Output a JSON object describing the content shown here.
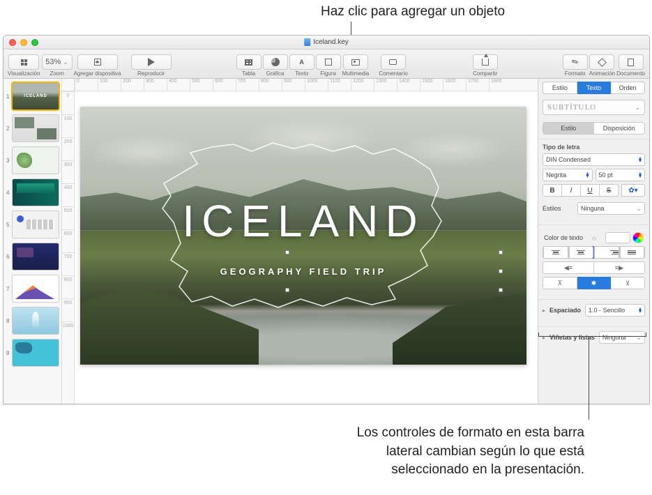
{
  "callouts": {
    "top": "Haz clic para agregar un objeto",
    "bottom": "Los controles de formato en esta barra\nlateral cambian según lo que está\nseleccionado en la presentación."
  },
  "window": {
    "title": "Iceland.key"
  },
  "toolbar": {
    "view": "Visualización",
    "zoom_value": "53%",
    "zoom": "Zoom",
    "add_slide": "Agregar dispositiva",
    "play": "Reproducir",
    "table": "Tabla",
    "chart": "Gráfica",
    "text": "Texto",
    "shape": "Figura",
    "media": "Multimedia",
    "comment": "Comentario",
    "share": "Compartir",
    "format": "Formato",
    "animation": "Animación",
    "document": "Documento"
  },
  "slide": {
    "title": "ICELAND",
    "subtitle": "GEOGRAPHY FIELD TRIP"
  },
  "ruler_h": [
    "0",
    "100",
    "200",
    "300",
    "400",
    "500",
    "600",
    "700",
    "800",
    "900",
    "1000",
    "1100",
    "1200",
    "1300",
    "1400",
    "1500",
    "1600",
    "1700",
    "1800"
  ],
  "ruler_v": [
    "0",
    "100",
    "200",
    "300",
    "400",
    "500",
    "600",
    "700",
    "800",
    "900",
    "1000"
  ],
  "thumbs": [
    "1",
    "2",
    "3",
    "4",
    "5",
    "6",
    "7",
    "8",
    "9"
  ],
  "inspector": {
    "tabs_main": {
      "style": "Estilo",
      "text": "Texto",
      "order": "Orden"
    },
    "paragraph_style": "SUBTÍTULO",
    "tabs_text": {
      "style": "Estilo",
      "layout": "Disposición"
    },
    "font_section": "Tipo de letra",
    "font_family": "DIN Condensed",
    "font_face": "Negrita",
    "font_size": "50 pt",
    "btn_bold": "B",
    "btn_italic": "I",
    "btn_under": "U",
    "btn_strike": "S",
    "character_styles": "Estilos",
    "char_style_value": "Ninguna",
    "text_color": "Color de texto",
    "spacing": "Espaciado",
    "spacing_value": "1.0 - Sencillo",
    "bullets": "Viñetas y listas",
    "bullets_value": "Ninguna"
  }
}
